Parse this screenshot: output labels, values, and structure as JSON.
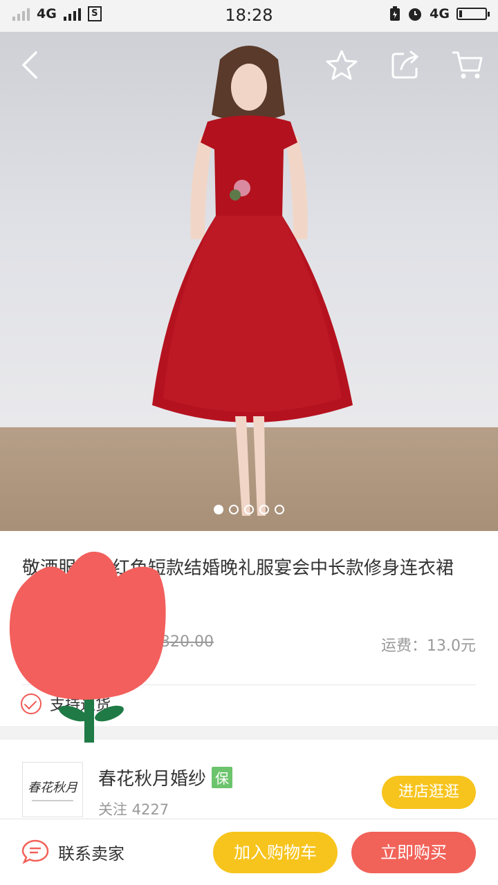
{
  "status_bar": {
    "network_left": "4G",
    "time": "18:28",
    "network_right": "4G",
    "sim_label": "S",
    "battery_level": 0.1
  },
  "hero": {
    "image_dot_count": 5,
    "active_dot": 0,
    "icons": [
      "back-icon",
      "star-icon",
      "share-icon",
      "cart-icon"
    ]
  },
  "product": {
    "title": "敬酒服新娘红色短款结婚晚礼服宴会中长款修身连衣裙",
    "orig_price": "320.00",
    "shipping": "运费：13.0元",
    "support_text": "支持退货"
  },
  "store": {
    "logo_text": "春花秋月",
    "name": "春花秋月婚纱",
    "badge": "保",
    "followers": "关注 4227",
    "visit_button": "进店逛逛"
  },
  "bottom_bar": {
    "contact": "联系卖家",
    "add_to_cart": "加入购物车",
    "buy_now": "立即购买"
  },
  "colors": {
    "yellow": "#f7c41d",
    "red": "#f16259",
    "green_badge": "#6cc46c",
    "tulip": "#f25f5c",
    "stem": "#1f7a45"
  }
}
